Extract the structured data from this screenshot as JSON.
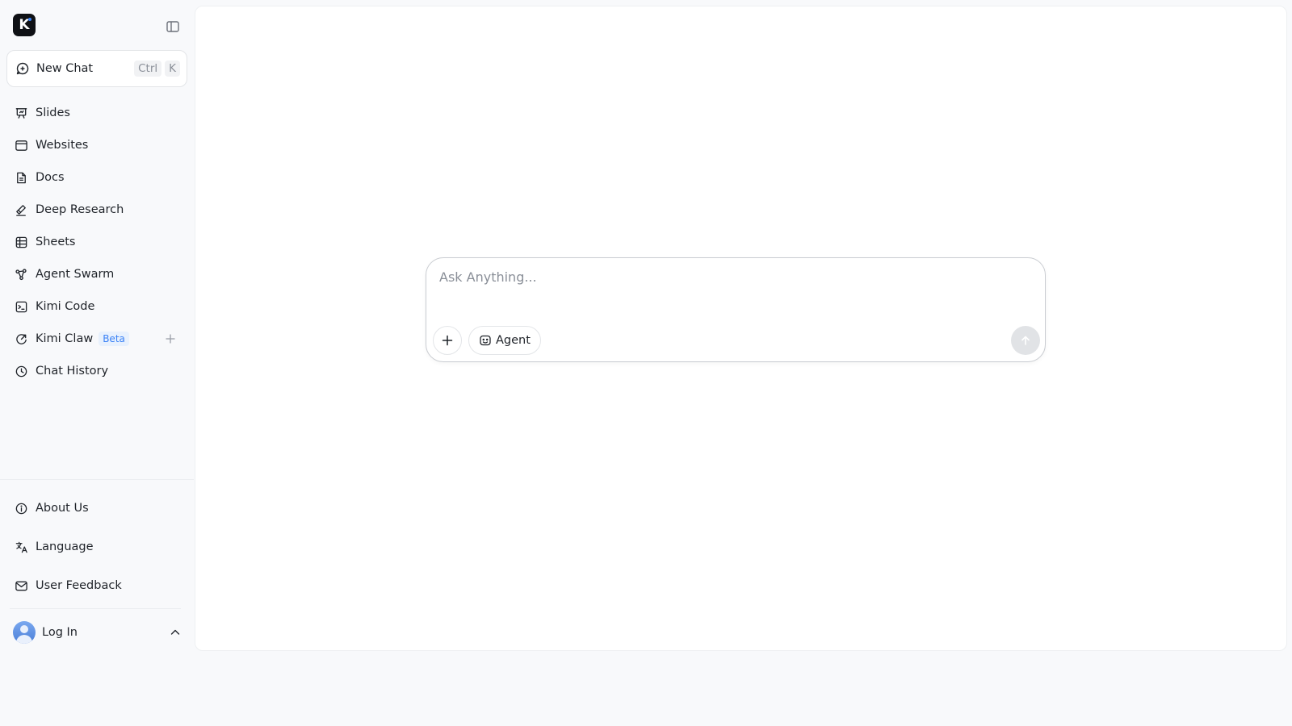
{
  "app": {
    "logo_letter": "K"
  },
  "sidebar": {
    "new_chat": {
      "label": "New Chat",
      "shortcut": [
        "Ctrl",
        "K"
      ]
    },
    "items": [
      {
        "label": "Slides",
        "icon": "presentation-icon"
      },
      {
        "label": "Websites",
        "icon": "browser-window-icon"
      },
      {
        "label": "Docs",
        "icon": "document-icon"
      },
      {
        "label": "Deep Research",
        "icon": "research-icon"
      },
      {
        "label": "Sheets",
        "icon": "table-icon"
      },
      {
        "label": "Agent Swarm",
        "icon": "swarm-icon"
      },
      {
        "label": "Kimi Code",
        "icon": "terminal-icon"
      },
      {
        "label": "Kimi Claw",
        "icon": "claw-icon",
        "badge": "Beta"
      },
      {
        "label": "Chat History",
        "icon": "clock-icon"
      }
    ],
    "bottom_items": [
      {
        "label": "About Us",
        "icon": "info-icon"
      },
      {
        "label": "Language",
        "icon": "translate-icon"
      },
      {
        "label": "User Feedback",
        "icon": "mail-icon"
      }
    ],
    "user": {
      "label": "Log In"
    }
  },
  "composer": {
    "placeholder": "Ask Anything...",
    "agent_label": "Agent"
  },
  "colors": {
    "accent": "#3b82f6",
    "badge_bg": "#e8f1fd",
    "send_disabled": "#e1e3e6"
  }
}
